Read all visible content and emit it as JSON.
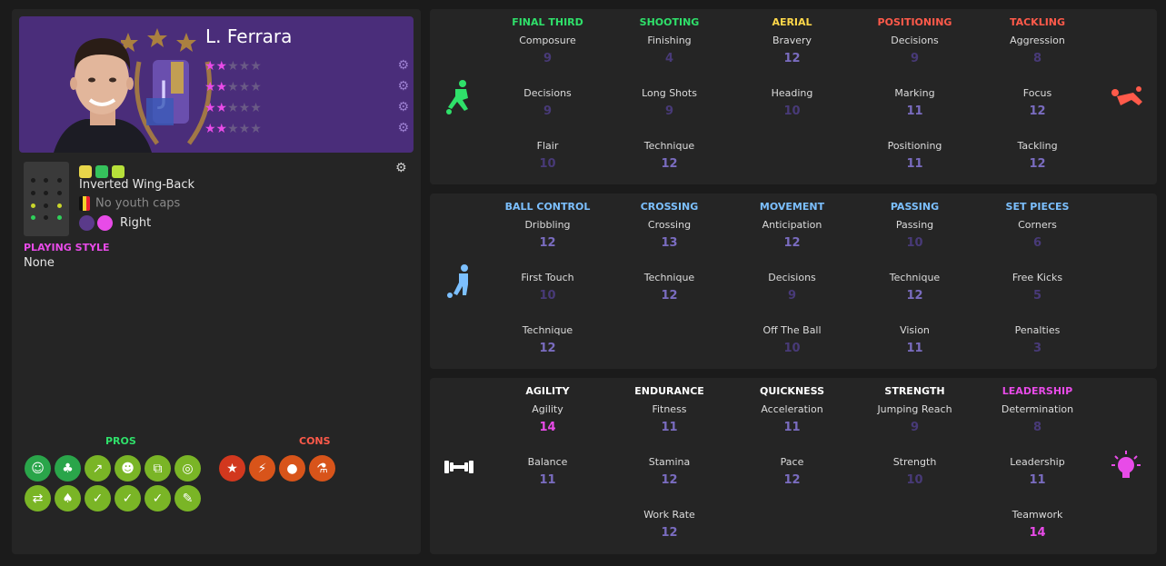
{
  "player": {
    "name": "L. Ferrara",
    "position": "Inverted Wing-Back",
    "youth_caps": "No youth caps",
    "foot": "Right",
    "playing_style_label": "PLAYING STYLE",
    "playing_style": "None",
    "role_ratings": [
      {
        "rating": 2,
        "max": 5
      },
      {
        "rating": 2,
        "max": 5
      },
      {
        "rating": 2,
        "max": 5
      },
      {
        "rating": 2,
        "max": 5
      }
    ]
  },
  "pros": {
    "title": "PROS",
    "icons": [
      "crowd-green-icon",
      "leaf-green-icon",
      "trend-up-icon",
      "head-icon",
      "chain-icon",
      "rings-icon",
      "swap-arrows-icon",
      "plant-icon",
      "clipboard-check-icon",
      "clipboard-check-icon",
      "clipboard-check-icon",
      "clipboard-edit-icon"
    ]
  },
  "cons": {
    "title": "CONS",
    "icons": [
      "star-icon",
      "broken-chain-icon",
      "ball-icon",
      "flask-icon"
    ]
  },
  "colors": {
    "green": "#2fe06a",
    "yellow": "#ffd84a",
    "red": "#ff5a4a",
    "blue": "#7cc0ff",
    "white": "#ffffff",
    "pink": "#e84be8"
  },
  "panels": [
    {
      "categories": [
        {
          "title": "FINAL THIRD",
          "color": "#2fe06a",
          "attrs": [
            {
              "name": "Composure",
              "value": 9
            },
            {
              "name": "Decisions",
              "value": 9
            },
            {
              "name": "Flair",
              "value": 10
            }
          ]
        },
        {
          "title": "SHOOTING",
          "color": "#2fe06a",
          "attrs": [
            {
              "name": "Finishing",
              "value": 4
            },
            {
              "name": "Long Shots",
              "value": 9
            },
            {
              "name": "Technique",
              "value": 12
            }
          ]
        },
        {
          "title": "AERIAL",
          "color": "#ffd84a",
          "attrs": [
            {
              "name": "Bravery",
              "value": 12
            },
            {
              "name": "Heading",
              "value": 10
            }
          ]
        },
        {
          "title": "POSITIONING",
          "color": "#ff5a4a",
          "attrs": [
            {
              "name": "Decisions",
              "value": 9
            },
            {
              "name": "Marking",
              "value": 11
            },
            {
              "name": "Positioning",
              "value": 11
            }
          ]
        },
        {
          "title": "TACKLING",
          "color": "#ff5a4a",
          "attrs": [
            {
              "name": "Aggression",
              "value": 8
            },
            {
              "name": "Focus",
              "value": 12
            },
            {
              "name": "Tackling",
              "value": 12
            }
          ]
        }
      ]
    },
    {
      "categories": [
        {
          "title": "BALL CONTROL",
          "color": "#7cc0ff",
          "attrs": [
            {
              "name": "Dribbling",
              "value": 12
            },
            {
              "name": "First Touch",
              "value": 10
            },
            {
              "name": "Technique",
              "value": 12
            }
          ]
        },
        {
          "title": "CROSSING",
          "color": "#7cc0ff",
          "attrs": [
            {
              "name": "Crossing",
              "value": 13
            },
            {
              "name": "Technique",
              "value": 12
            }
          ]
        },
        {
          "title": "MOVEMENT",
          "color": "#7cc0ff",
          "attrs": [
            {
              "name": "Anticipation",
              "value": 12
            },
            {
              "name": "Decisions",
              "value": 9
            },
            {
              "name": "Off The Ball",
              "value": 10
            }
          ]
        },
        {
          "title": "PASSING",
          "color": "#7cc0ff",
          "attrs": [
            {
              "name": "Passing",
              "value": 10
            },
            {
              "name": "Technique",
              "value": 12
            },
            {
              "name": "Vision",
              "value": 11
            }
          ]
        },
        {
          "title": "SET PIECES",
          "color": "#7cc0ff",
          "attrs": [
            {
              "name": "Corners",
              "value": 6
            },
            {
              "name": "Free Kicks",
              "value": 5
            },
            {
              "name": "Penalties",
              "value": 3
            }
          ]
        }
      ]
    },
    {
      "categories": [
        {
          "title": "AGILITY",
          "color": "#ffffff",
          "attrs": [
            {
              "name": "Agility",
              "value": 14
            },
            {
              "name": "Balance",
              "value": 11
            }
          ]
        },
        {
          "title": "ENDURANCE",
          "color": "#ffffff",
          "attrs": [
            {
              "name": "Fitness",
              "value": 11
            },
            {
              "name": "Stamina",
              "value": 12
            },
            {
              "name": "Work Rate",
              "value": 12
            }
          ]
        },
        {
          "title": "QUICKNESS",
          "color": "#ffffff",
          "attrs": [
            {
              "name": "Acceleration",
              "value": 11
            },
            {
              "name": "Pace",
              "value": 12
            }
          ]
        },
        {
          "title": "STRENGTH",
          "color": "#ffffff",
          "attrs": [
            {
              "name": "Jumping Reach",
              "value": 9
            },
            {
              "name": "Strength",
              "value": 10
            }
          ]
        },
        {
          "title": "LEADERSHIP",
          "color": "#e84be8",
          "attrs": [
            {
              "name": "Determination",
              "value": 8
            },
            {
              "name": "Leadership",
              "value": 11
            },
            {
              "name": "Teamwork",
              "value": 14
            }
          ]
        }
      ]
    }
  ]
}
